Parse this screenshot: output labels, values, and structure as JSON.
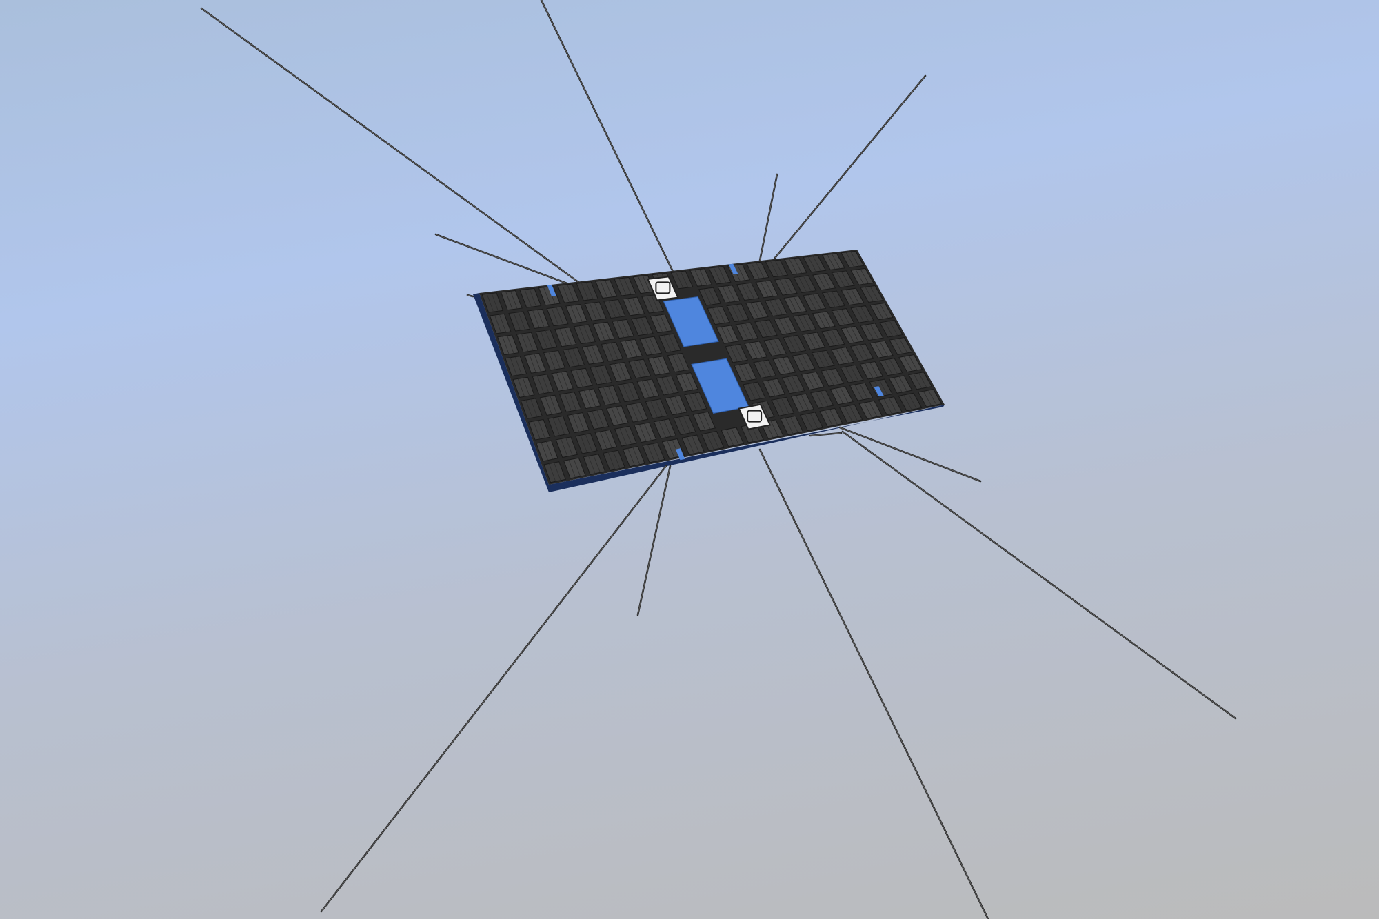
{
  "scene": {
    "subject": "satellite-model",
    "colors": {
      "background_top": "#b1c6ec",
      "background_bottom": "#bbbbbb",
      "solar_cell": "#3d3d3d",
      "solar_cell_edge": "#1a1a1a",
      "panel_edge": "#1b2f5c",
      "strip_blue": "#4f86de",
      "antenna": "#2b2b2b",
      "label_white": "#f2f2f2"
    },
    "grid": {
      "rows": 9,
      "cols": 20
    },
    "antenna_count": 12
  }
}
